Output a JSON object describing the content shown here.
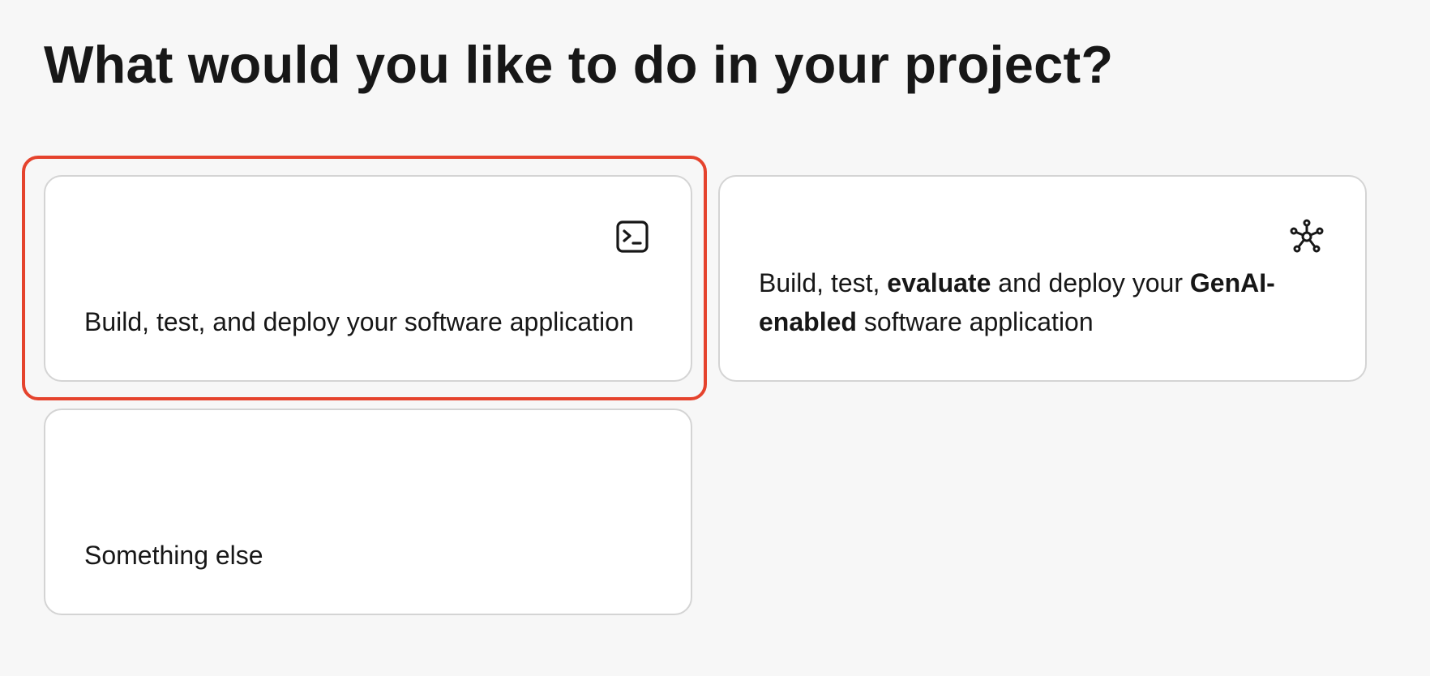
{
  "page": {
    "title": "What would you like to do in your project?"
  },
  "options": [
    {
      "icon": "terminal-icon",
      "text": "Build, test, and deploy your software application",
      "selected": true
    },
    {
      "icon": "network-nodes-icon",
      "text_parts": [
        "Build, test, ",
        "evaluate",
        " and deploy your ",
        "GenAI-enabled",
        " software application"
      ],
      "selected": false
    },
    {
      "icon": null,
      "text": "Something else",
      "selected": false
    }
  ],
  "colors": {
    "background": "#f7f7f7",
    "card_background": "#ffffff",
    "card_border": "#d4d4d4",
    "selection_outline": "#e5432d",
    "text": "#171717"
  }
}
